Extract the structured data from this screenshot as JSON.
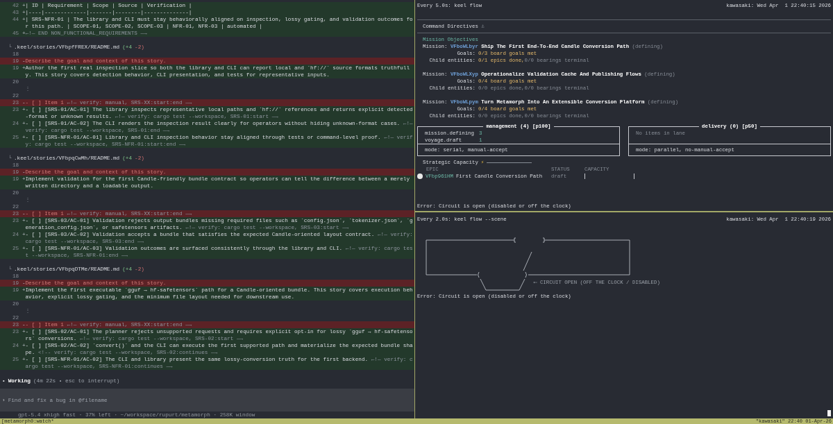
{
  "left_pane": {
    "diff_blocks": [
      {
        "rows": [
          {
            "kind": "add",
            "num": "42",
            "sign": "+",
            "text": "| ID | Requirement | Scope | Source | Verification |"
          },
          {
            "kind": "add",
            "num": "43",
            "sign": "+",
            "text": "|----|-------------|-------|--------|--------------|"
          },
          {
            "kind": "add",
            "num": "44",
            "sign": "+",
            "text": "| SRS-NFR-01 | The library and CLI must stay behaviorally aligned on inspection, lossy gating, and validation outcomes for this path. | SCOPE-01, SCOPE-02, SCOPE-03 | NFR-01, NFR-03 | automated |"
          },
          {
            "kind": "add",
            "num": "45",
            "sign": "+",
            "note": "←!— END NON_FUNCTIONAL_REQUIREMENTS —→"
          }
        ]
      },
      {
        "file": {
          "tree": "└",
          "path": ".keel/stories/VFbpfFREX/README.md",
          "added": "(+4",
          "removed": "-2)"
        },
        "rows": [
          {
            "kind": "context",
            "num": "18"
          },
          {
            "kind": "del",
            "num": "19",
            "sign": "-",
            "text": "Describe the goal and context of this story."
          },
          {
            "kind": "add",
            "num": "19",
            "sign": "+",
            "text": "Author the first real inspection slice so both the library and CLI can report local and `hf://` source formats truthfully. This story covers detection behavior, CLI presentation, and tests for representative inputs."
          },
          {
            "kind": "context",
            "num": "20"
          },
          {
            "kind": "gap",
            "glyph": "⋮"
          },
          {
            "kind": "context",
            "num": "22"
          },
          {
            "kind": "del",
            "num": "23",
            "sign": "-",
            "text": "- [ ] Item 1 ",
            "note": "←!— verify: manual, SRS-XX:start:end —→"
          },
          {
            "kind": "add",
            "num": "23",
            "sign": "+",
            "text": "- [ ] [SRS-01/AC-01] The library inspects representative local paths and `hf://` references and returns explicit detected-format or unknown results. ",
            "note": "←!— verify: cargo test --workspace, SRS-01:start —→"
          },
          {
            "kind": "add",
            "num": "24",
            "sign": "+",
            "text": "- [ ] [SRS-01/AC-02] The CLI renders the inspection result clearly for operators without hiding unknown-format cases. ",
            "note": "←!— verify: cargo test --workspace, SRS-01:end —→"
          },
          {
            "kind": "add",
            "num": "25",
            "sign": "+",
            "text": "- [ ] [SRS-NFR-01/AC-01] Library and CLI inspection behavior stay aligned through tests or command-level proof. ",
            "note": "←!— verify: cargo test --workspace, SRS-NFR-01:start:end —→"
          }
        ]
      },
      {
        "file": {
          "tree": "└",
          "path": ".keel/stories/VFbpqCwMh/README.md",
          "added": "(+4",
          "removed": "-2)"
        },
        "rows": [
          {
            "kind": "context",
            "num": "18"
          },
          {
            "kind": "del",
            "num": "19",
            "sign": "-",
            "text": "Describe the goal and context of this story."
          },
          {
            "kind": "add",
            "num": "19",
            "sign": "+",
            "text": "Implement validation for the first Candle-friendly bundle contract so operators can tell the difference between a merely written directory and a loadable output."
          },
          {
            "kind": "context",
            "num": "20"
          },
          {
            "kind": "gap",
            "glyph": "⋮"
          },
          {
            "kind": "context",
            "num": "22"
          },
          {
            "kind": "del",
            "num": "23",
            "sign": "-",
            "text": "- [ ] Item 1 ",
            "note": "←!— verify: manual, SRS-XX:start:end —→"
          },
          {
            "kind": "add",
            "num": "23",
            "sign": "+",
            "text": "- [ ] [SRS-03/AC-01] Validation rejects output bundles missing required files such as `config.json`, `tokenizer.json`, `generation_config.json`, or safetensors artifacts. ",
            "note": "←!— verify: cargo test --workspace, SRS-03:start —→"
          },
          {
            "kind": "add",
            "num": "24",
            "sign": "+",
            "text": "- [ ] [SRS-03/AC-02] Validation accepts a bundle that satisfies the expected Candle-oriented layout contract. ",
            "note": "←!— verify: cargo test --workspace, SRS-03:end —→"
          },
          {
            "kind": "add",
            "num": "25",
            "sign": "+",
            "text": "- [ ] [SRS-NFR-01/AC-03] Validation outcomes are surfaced consistently through the library and CLI. ",
            "note": "←!— verify: cargo test --workspace, SRS-NFR-01:end —→"
          }
        ]
      },
      {
        "file": {
          "tree": "└",
          "path": ".keel/stories/VFbpqDTMe/README.md",
          "added": "(+4",
          "removed": "-2)"
        },
        "rows": [
          {
            "kind": "context",
            "num": "18"
          },
          {
            "kind": "del",
            "num": "19",
            "sign": "-",
            "text": "Describe the goal and context of this story."
          },
          {
            "kind": "add",
            "num": "19",
            "sign": "+",
            "text": "Implement the first executable `gguf → hf-safetensors` path for a Candle-oriented bundle. This story covers execution behavior, explicit lossy gating, and the minimum file layout needed for downstream use."
          },
          {
            "kind": "context",
            "num": "20"
          },
          {
            "kind": "gap",
            "glyph": "⋮"
          },
          {
            "kind": "context",
            "num": "22"
          },
          {
            "kind": "del",
            "num": "23",
            "sign": "-",
            "text": "- [ ] Item 1 ",
            "note": "←!— verify: manual, SRS-XX:start:end —→"
          },
          {
            "kind": "add",
            "num": "23",
            "sign": "+",
            "text": "- [ ] [SRS-02/AC-01] The planner rejects unsupported requests and requires explicit opt-in for lossy `gguf → hf-safetensors` conversions. ",
            "note": "←!— verify: cargo test --workspace, SRS-02:start —→"
          },
          {
            "kind": "add",
            "num": "24",
            "sign": "+",
            "text": "- [ ] [SRS-02/AC-02] `convert()` and the CLI can execute the first supported path and materialize the expected bundle shape. ",
            "note": "<!-- verify: cargo test --workspace, SRS-02:continues —→"
          },
          {
            "kind": "add",
            "num": "25",
            "sign": "+",
            "text": "- [ ] [SRS-NFR-01/AC-02] The CLI and library present the same lossy-conversion truth for the first backend. ",
            "note": "←!— verify: cargo test --workspace, SRS-NFR-01:continues —→"
          }
        ]
      }
    ],
    "status": {
      "bullet": "•",
      "label": "Working",
      "detail": "(4m 22s • esc to interrupt)"
    },
    "composer": {
      "prompt": "›",
      "placeholder": "Find and fix a bug in @filename"
    },
    "footer": "gpt-5.4 xhigh fast · 37% left · ~/workspace/rupurt/metamorph · 258K window"
  },
  "flow_pane": {
    "command": "Every 5.0s: keel flow",
    "host_time": "kawasaki: Wed Apr  1 22:40:15 2026",
    "directives_title": "Command Directives",
    "directives_icon": "⚓",
    "capacity_icon": "⚡",
    "objectives_title": "Mission Objectives",
    "missions": [
      {
        "label": "Mission:",
        "id": "VFboWLbyr",
        "title": "Ship The First End-To-End Candle Conversion Path",
        "status": "(defining)",
        "goals_label": "Goals:",
        "goals": "0/3 board goals met",
        "child_label": "Child entities:",
        "epics": "0/1 epics done,",
        "epics_active": true,
        "bearings": "0/0 bearings terminal"
      },
      {
        "label": "Mission:",
        "id": "VFboWLXyp",
        "title": "Operationalize Validation Cache And Publishing Flows",
        "status": "(defining)",
        "goals_label": "Goals:",
        "goals": "0/4 board goals met",
        "child_label": "Child entities:",
        "epics": "0/0 epics done,",
        "epics_active": false,
        "bearings": "0/0 bearings terminal"
      },
      {
        "label": "Mission:",
        "id": "VFboWLpym",
        "title": "Turn Metamorph Into An Extensible Conversion Platform",
        "status": "(defining)",
        "goals_label": "Goals:",
        "goals": "0/4 board goals met",
        "child_label": "Child entities:",
        "epics": "0/0 epics done,",
        "epics_active": false,
        "bearings": "0/0 bearings terminal"
      }
    ],
    "lanes": [
      {
        "title": "management (4) [p100]",
        "rows": [
          {
            "key": "mission.defining",
            "count": "3"
          },
          {
            "key": "voyage.draft",
            "count": "1"
          }
        ],
        "mode": "mode: serial, manual-accept"
      },
      {
        "title": "delivery (0) [p50]",
        "empty": "No items in lane",
        "mode": "mode: parallel, no-manual-accept"
      }
    ],
    "capacity": {
      "title": "Strategic Capacity",
      "columns": [
        "EPIC",
        "STATUS",
        "CAPACITY"
      ],
      "rows": [
        {
          "id": "VFbp961HM",
          "title": "First Candle Conversion Path",
          "status": "draft",
          "level": 0
        }
      ]
    },
    "error": "Error: Circuit is open (disabled or off the clock)"
  },
  "scene_pane": {
    "command": "Every 2.0s: keel flow --scene",
    "host_time": "kawasaki: Wed Apr  1 22:40:19 2026",
    "circuit_label": "⟵ CIRCUIT OPEN (OFF THE CLOCK / DISABLED)",
    "error": "Error: Circuit is open (disabled or off the clock)"
  },
  "status_bar": {
    "session": "[metamorph0:watch*",
    "host_clock": "\"kawasaki\" 22:40 01-Apr-26"
  }
}
